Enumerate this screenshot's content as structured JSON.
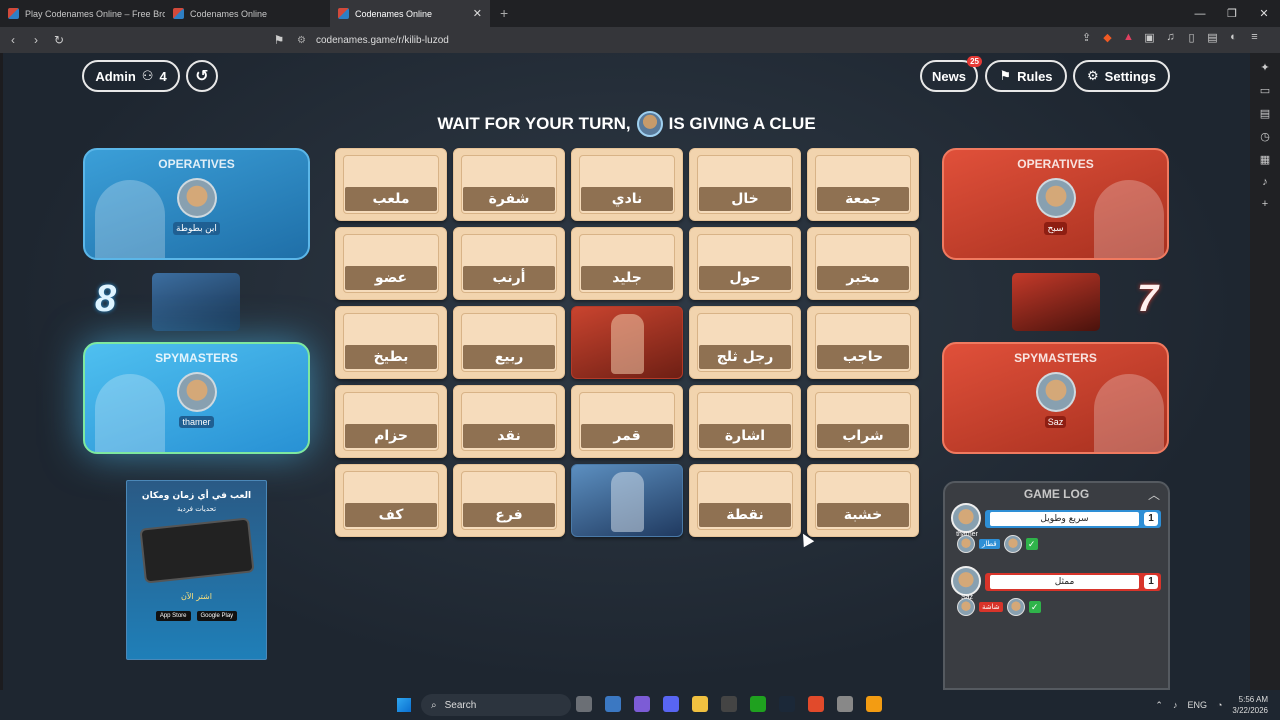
{
  "browser": {
    "tabs": [
      {
        "title": "Play Codenames Online – Free Brows",
        "active": false
      },
      {
        "title": "Codenames Online",
        "active": false
      },
      {
        "title": "Codenames Online",
        "active": true
      }
    ],
    "url": "codenames.game/r/kilib-luzod"
  },
  "game": {
    "admin_label": "Admin",
    "players_count": "4",
    "news_label": "News",
    "news_badge": "25",
    "rules_label": "Rules",
    "settings_label": "Settings",
    "banner_prefix": "WAIT FOR YOUR TURN,",
    "banner_suffix": "IS GIVING A CLUE",
    "banner_player": "thamer",
    "blue": {
      "operatives_title": "OPERATIVES",
      "operative_name": "ابن بطوطة",
      "spymasters_title": "SPYMASTERS",
      "spymaster_name": "thamer",
      "score": "8"
    },
    "red": {
      "operatives_title": "OPERATIVES",
      "operative_name": "سبح",
      "spymasters_title": "SPYMASTERS",
      "spymaster_name": "Saz",
      "score": "7"
    },
    "cards": [
      {
        "word": "ملعب",
        "state": "hidden"
      },
      {
        "word": "شفرة",
        "state": "hidden"
      },
      {
        "word": "نادي",
        "state": "hidden"
      },
      {
        "word": "خال",
        "state": "hidden"
      },
      {
        "word": "جمعة",
        "state": "hidden"
      },
      {
        "word": "عضو",
        "state": "hidden"
      },
      {
        "word": "أرنب",
        "state": "hidden"
      },
      {
        "word": "جليد",
        "state": "hidden"
      },
      {
        "word": "حول",
        "state": "hidden"
      },
      {
        "word": "مخبر",
        "state": "hidden"
      },
      {
        "word": "بطيخ",
        "state": "hidden"
      },
      {
        "word": "ربيع",
        "state": "hidden"
      },
      {
        "word": "",
        "state": "red"
      },
      {
        "word": "رجل ثلج",
        "state": "hidden"
      },
      {
        "word": "حاجب",
        "state": "hidden"
      },
      {
        "word": "حزام",
        "state": "hidden"
      },
      {
        "word": "نقد",
        "state": "hidden"
      },
      {
        "word": "قمر",
        "state": "hidden"
      },
      {
        "word": "اشارة",
        "state": "hidden"
      },
      {
        "word": "شراب",
        "state": "hidden"
      },
      {
        "word": "كف",
        "state": "hidden"
      },
      {
        "word": "فرع",
        "state": "hidden"
      },
      {
        "word": "",
        "state": "blue"
      },
      {
        "word": "نقطة",
        "state": "hidden"
      },
      {
        "word": "خشبة",
        "state": "hidden"
      }
    ],
    "ad": {
      "line1": "العب في أي زمان ومكان",
      "line2": "تحديات فردية",
      "cta": "اشتر الآن",
      "store1": "App Store",
      "store2": "Google Play"
    },
    "game_log": {
      "title": "GAME LOG",
      "entries": [
        {
          "team": "blue",
          "player": "thamer",
          "clue": "سريع وطويل",
          "number": "1",
          "guess_tag": "قطار"
        },
        {
          "team": "red",
          "player": "Saz",
          "clue": "ممثل",
          "number": "1",
          "guess_tag": "شاشة"
        }
      ]
    }
  },
  "taskbar": {
    "search_label": "Search",
    "lang": "ENG",
    "time": "5:56 AM",
    "date": "3/22/2026"
  }
}
